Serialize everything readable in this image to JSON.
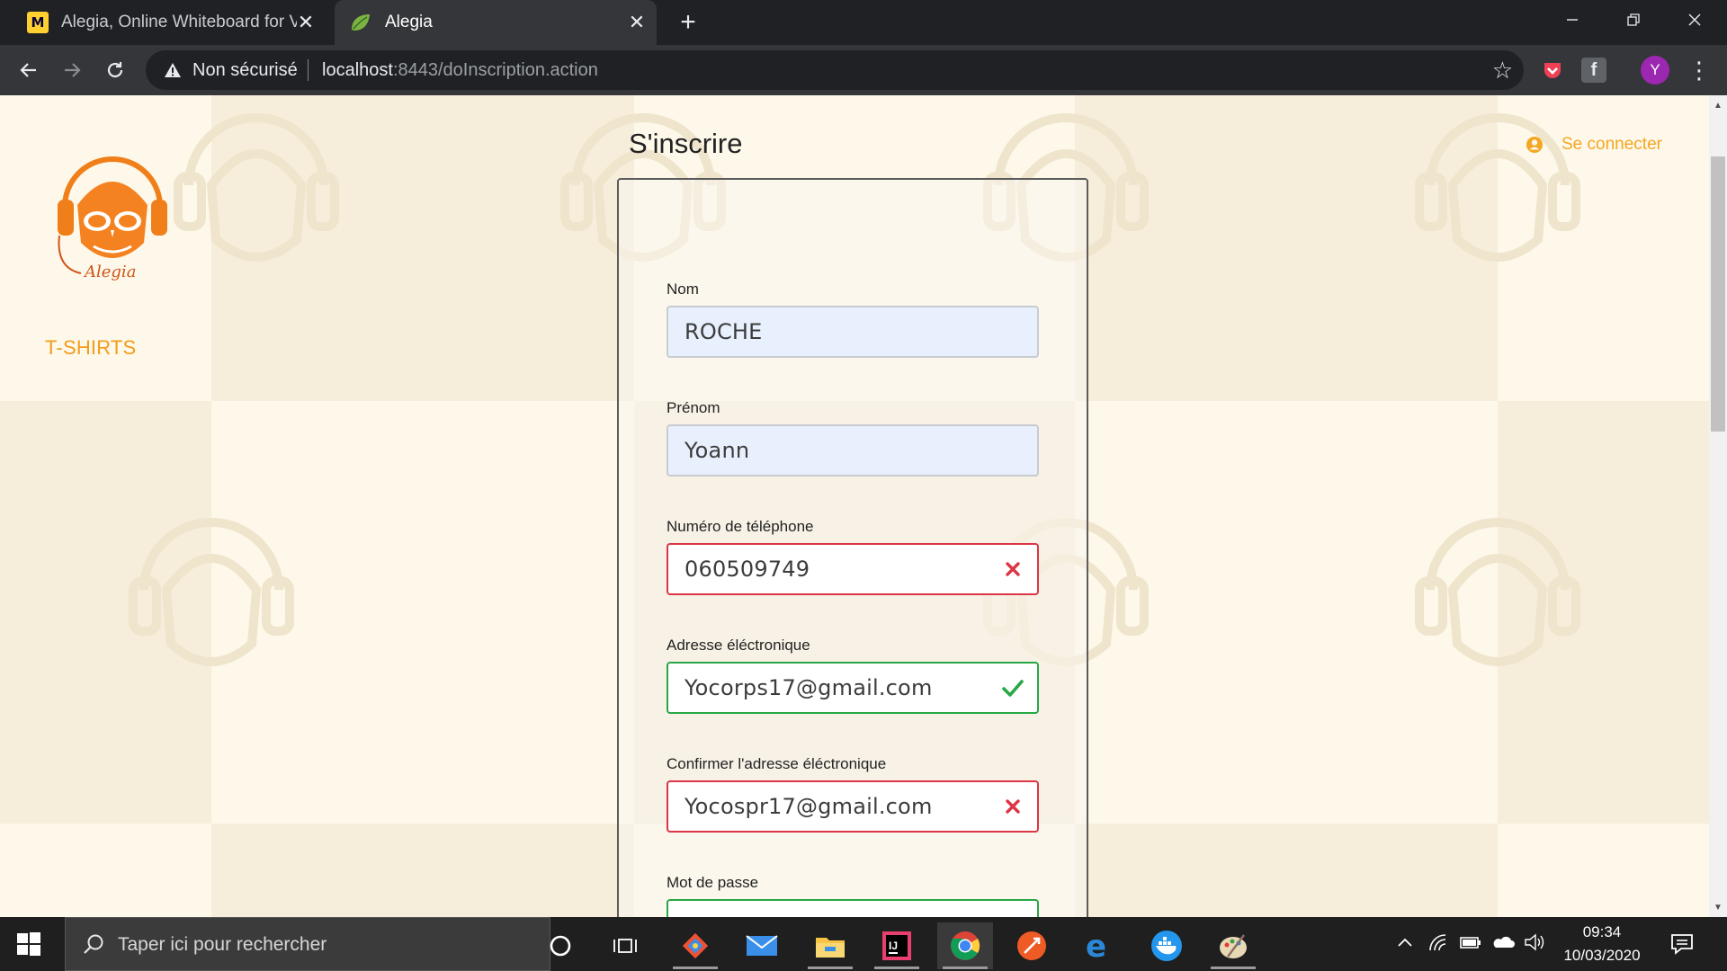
{
  "browser": {
    "tabs": [
      {
        "title": "Alegia, Online Whiteboard for Vi",
        "favicon": "miro-icon",
        "active": false
      },
      {
        "title": "Alegia",
        "favicon": "spring-leaf-icon",
        "active": true
      }
    ],
    "security_label": "Non sécurisé",
    "url_host": "localhost",
    "url_rest": ":8443/doInscription.action",
    "profile_initial": "Y"
  },
  "header": {
    "nav_tshirts": "T-SHIRTS",
    "connect_label": "Se connecter"
  },
  "form": {
    "title": "S'inscrire",
    "fields": [
      {
        "label": "Nom",
        "value": "ROCHE",
        "state": "autofill"
      },
      {
        "label": "Prénom",
        "value": "Yoann",
        "state": "autofill"
      },
      {
        "label": "Numéro de téléphone",
        "value": "060509749",
        "state": "invalid"
      },
      {
        "label": "Adresse éléctronique",
        "value": "Yocorps17@gmail.com",
        "state": "valid"
      },
      {
        "label": "Confirmer l'adresse éléctronique",
        "value": "Yocospr17@gmail.com",
        "state": "invalid"
      },
      {
        "label": "Mot de passe",
        "value": "•••••••••",
        "state": "valid"
      }
    ]
  },
  "taskbar": {
    "search_placeholder": "Taper ici pour rechercher",
    "time": "09:34",
    "date": "10/03/2020"
  },
  "colors": {
    "accent_orange": "#f39c1a",
    "valid_green": "#28a745",
    "invalid_red": "#dc3545",
    "page_bg": "#f8f1e2"
  }
}
